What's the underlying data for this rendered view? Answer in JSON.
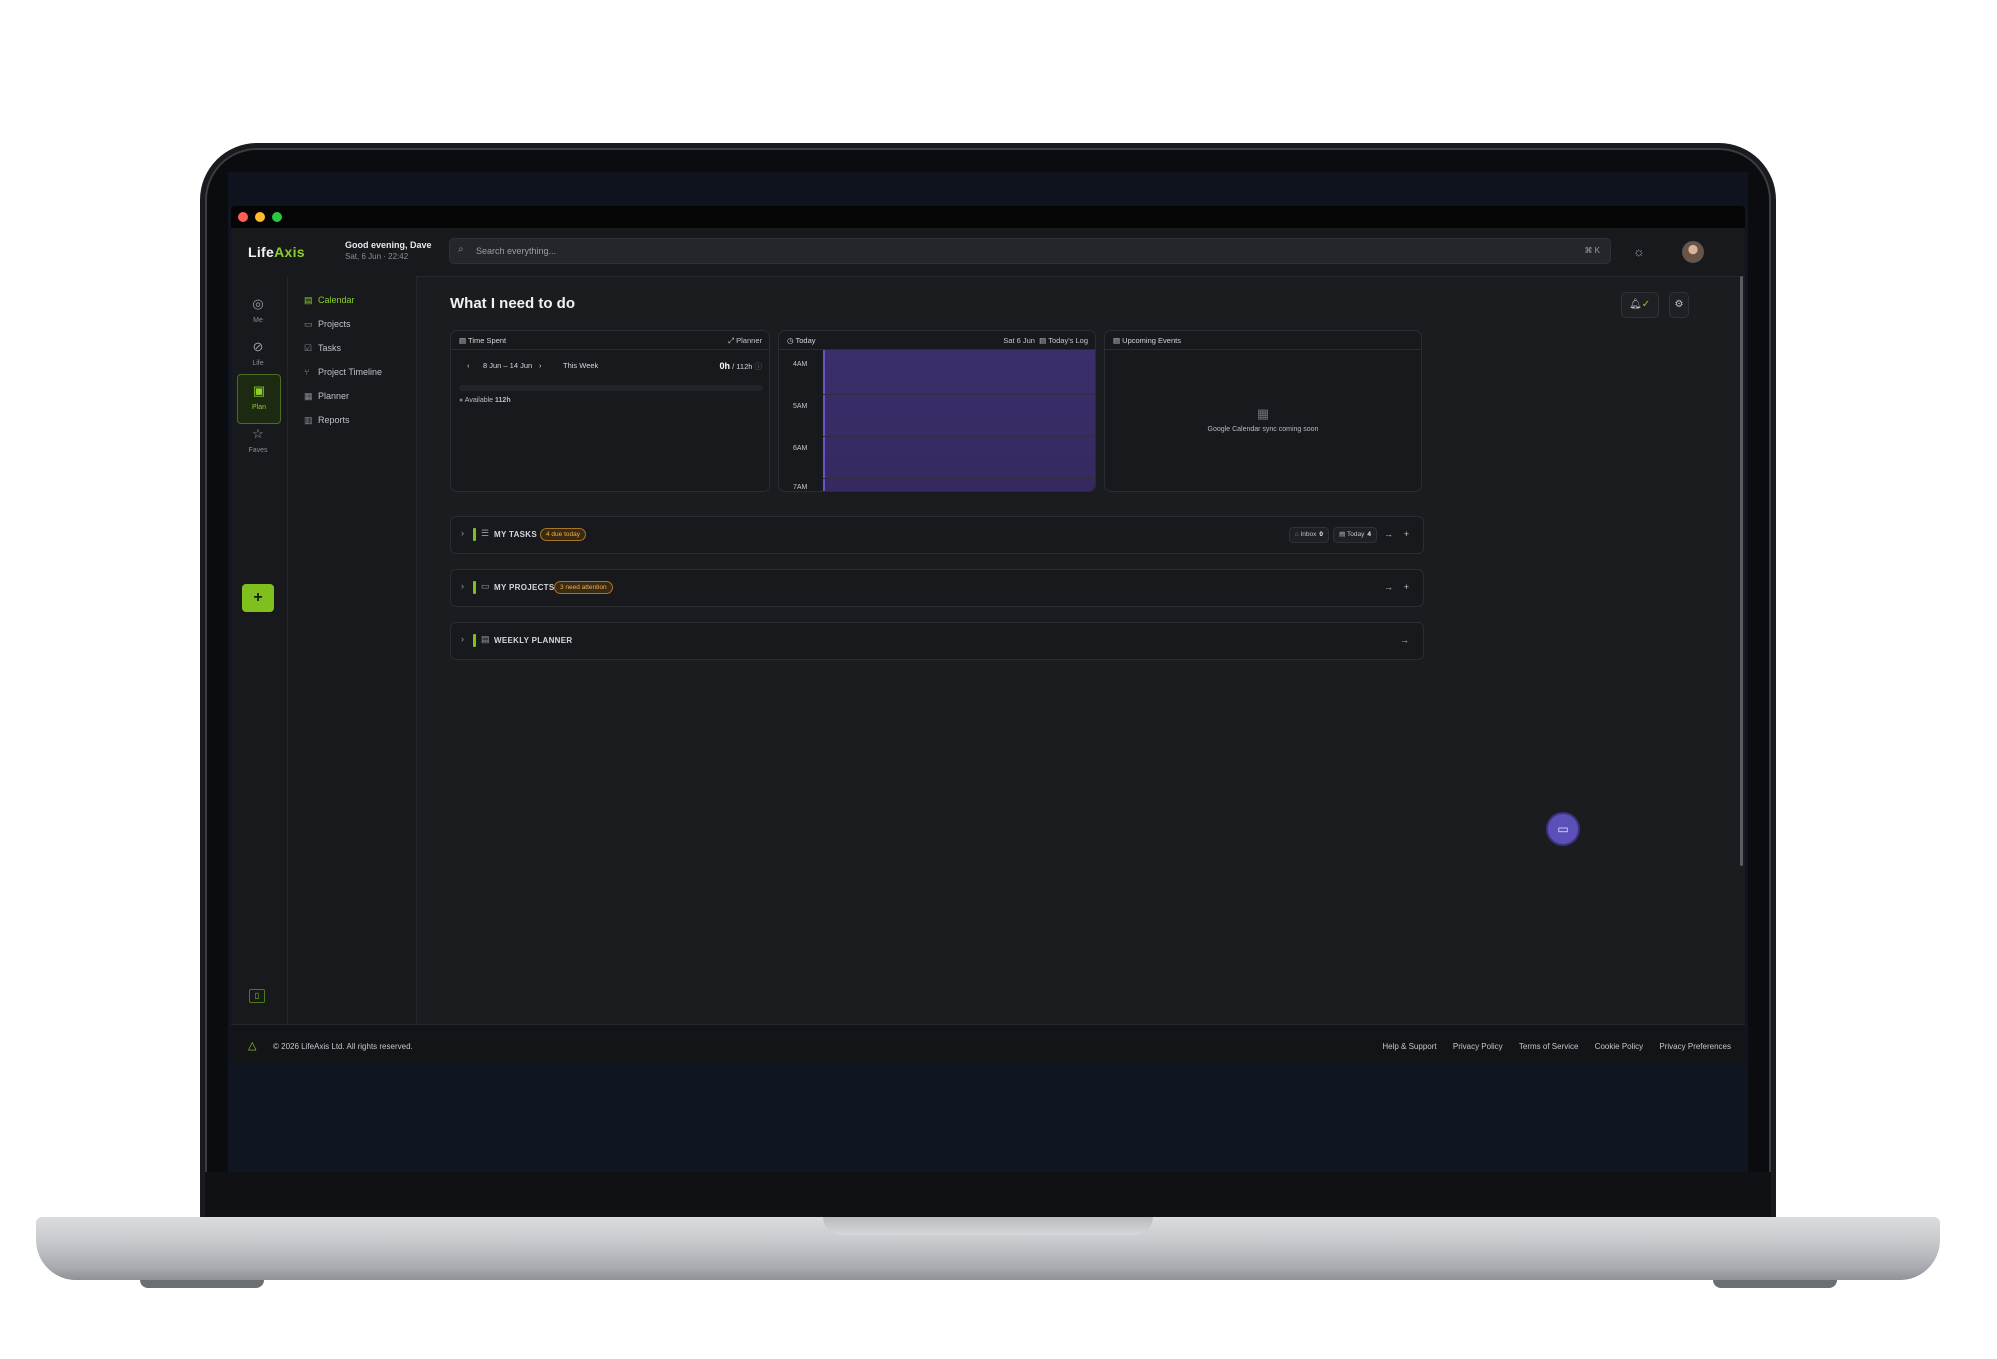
{
  "app": {
    "logo_prefix": "Life",
    "logo_accent": "A",
    "logo_suffix": "xis",
    "greeting": "Good evening, Dave",
    "datetime": "Sat, 6 Jun · 22:42"
  },
  "search": {
    "placeholder": "Search everything...",
    "shortcut": "⌘ K"
  },
  "rail": {
    "items": [
      {
        "label": "Me",
        "icon": "user-icon"
      },
      {
        "label": "Life",
        "icon": "compass-icon"
      },
      {
        "label": "Plan",
        "icon": "clipboard-icon"
      },
      {
        "label": "Faves",
        "icon": "star-icon"
      }
    ],
    "add_label": "+"
  },
  "subnav": {
    "items": [
      {
        "label": "Calendar",
        "icon": "calendar-icon"
      },
      {
        "label": "Projects",
        "icon": "folder-icon"
      },
      {
        "label": "Tasks",
        "icon": "checkbox-icon"
      },
      {
        "label": "Project Timeline",
        "icon": "branch-icon"
      },
      {
        "label": "Planner",
        "icon": "grid-icon"
      },
      {
        "label": "Reports",
        "icon": "bar-chart-icon"
      }
    ]
  },
  "main": {
    "title": "What I need to do",
    "time_spent": {
      "title": "Time Spent",
      "action": "Planner",
      "range": "8 Jun – 14 Jun",
      "period": "This Week",
      "hours": "0h",
      "total": "/ 112h",
      "available_label": "Available",
      "available_value": "112h"
    },
    "today": {
      "title": "Today",
      "date": "Sat 6 Jun",
      "log_label": "Today's Log",
      "hours": [
        "4AM",
        "5AM",
        "6AM",
        "7AM"
      ]
    },
    "upcoming": {
      "title": "Upcoming Events",
      "message": "Google Calendar sync coming soon"
    },
    "sections": {
      "tasks": {
        "title": "MY TASKS",
        "badge": "4 due today",
        "inbox_label": "Inbox",
        "inbox_count": "0",
        "today_label": "Today",
        "today_count": "4"
      },
      "projects": {
        "title": "MY PROJECTS",
        "badge": "3 need attention"
      },
      "planner": {
        "title": "WEEKLY PLANNER"
      }
    }
  },
  "footer": {
    "copyright": "© 2026 LifeAxis Ltd. All rights reserved.",
    "links": [
      "Help & Support",
      "Privacy Policy",
      "Terms of Service",
      "Cookie Policy",
      "Privacy Preferences"
    ]
  },
  "colors": {
    "accent": "#8ccf2b",
    "event": "#3a2f6b",
    "badge": "#f0b04a",
    "chat": "#5b4fb8"
  }
}
